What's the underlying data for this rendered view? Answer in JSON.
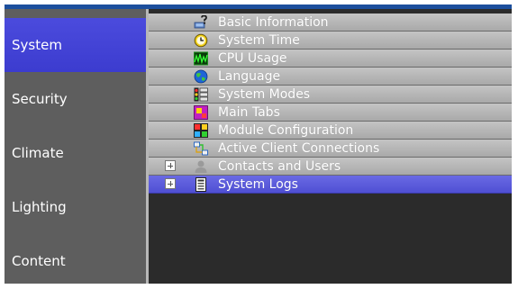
{
  "sidebar": {
    "items": [
      {
        "label": "System",
        "active": true
      },
      {
        "label": "Security",
        "active": false
      },
      {
        "label": "Climate",
        "active": false
      },
      {
        "label": "Lighting",
        "active": false
      },
      {
        "label": "Content",
        "active": false
      }
    ]
  },
  "rows": [
    {
      "label": "Basic Information",
      "icon": "question-computer-icon"
    },
    {
      "label": "System Time",
      "icon": "clock-icon"
    },
    {
      "label": "CPU Usage",
      "icon": "cpu-graph-icon"
    },
    {
      "label": "Language",
      "icon": "globe-icon"
    },
    {
      "label": "System Modes",
      "icon": "modes-icon"
    },
    {
      "label": "Main Tabs",
      "icon": "tabs-icon"
    },
    {
      "label": "Module Configuration",
      "icon": "module-grid-icon"
    },
    {
      "label": "Active Client Connections",
      "icon": "network-icon"
    },
    {
      "label": "Contacts and Users",
      "icon": "user-icon",
      "expandable": true
    },
    {
      "label": "System Logs",
      "icon": "document-icon",
      "expandable": true,
      "selected": true
    }
  ],
  "colors": {
    "sidebar_bg": "#5e5e5e",
    "active_blue": "#4646d8",
    "row_gray": "#b5b5b5",
    "topbar_blue": "#1c4f9d"
  }
}
